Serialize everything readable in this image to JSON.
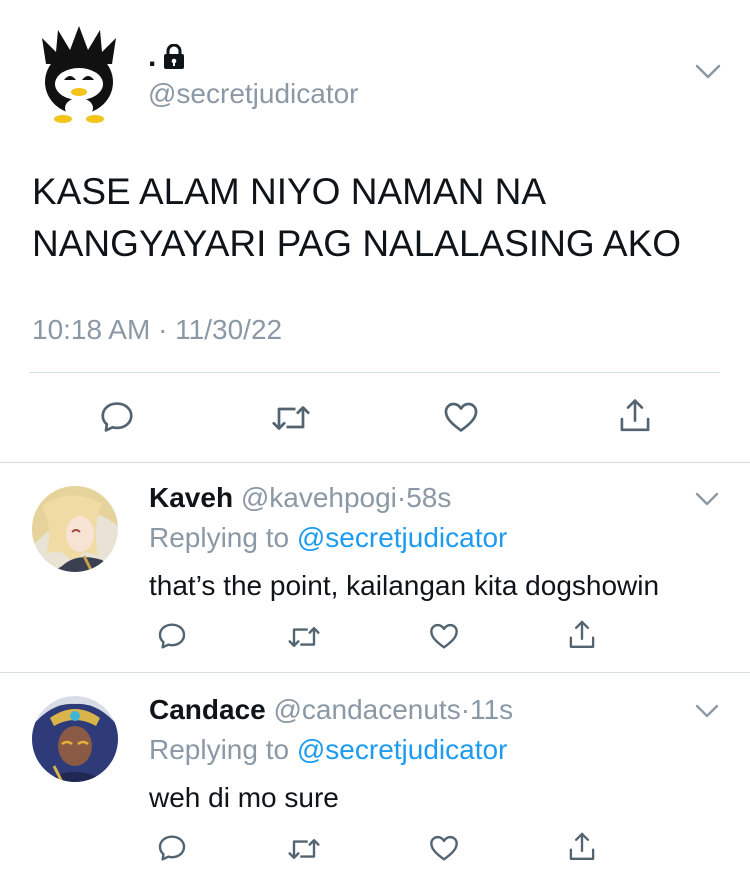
{
  "main_tweet": {
    "display_name": ".",
    "handle": "@secretjudicator",
    "text_lines": [
      "KASE ALAM NIYO NAMAN NA",
      "NANGYAYARI PAG NALALASING AKO"
    ],
    "timestamp": "10:18 AM · 11/30/22",
    "actions": [
      "reply-icon",
      "retweet-icon",
      "like-icon",
      "share-icon"
    ]
  },
  "replies": [
    {
      "name": "Kaveh",
      "handle": "@kavehpogi",
      "sep": "·",
      "time": "58s",
      "replying_prefix": "Replying to",
      "replying_to": "@secretjudicator",
      "text": "that’s the point, kailangan kita dogshowin"
    },
    {
      "name": "Candace",
      "handle": "@candacenuts",
      "sep": "·",
      "time": "11s",
      "replying_prefix": "Replying to",
      "replying_to": "@secretjudicator",
      "text": "weh di mo sure"
    }
  ],
  "colors": {
    "link": "#1d9bf0",
    "secondary_text": "#8b98a5",
    "divider": "#d9dee2",
    "icon": "#536471"
  }
}
